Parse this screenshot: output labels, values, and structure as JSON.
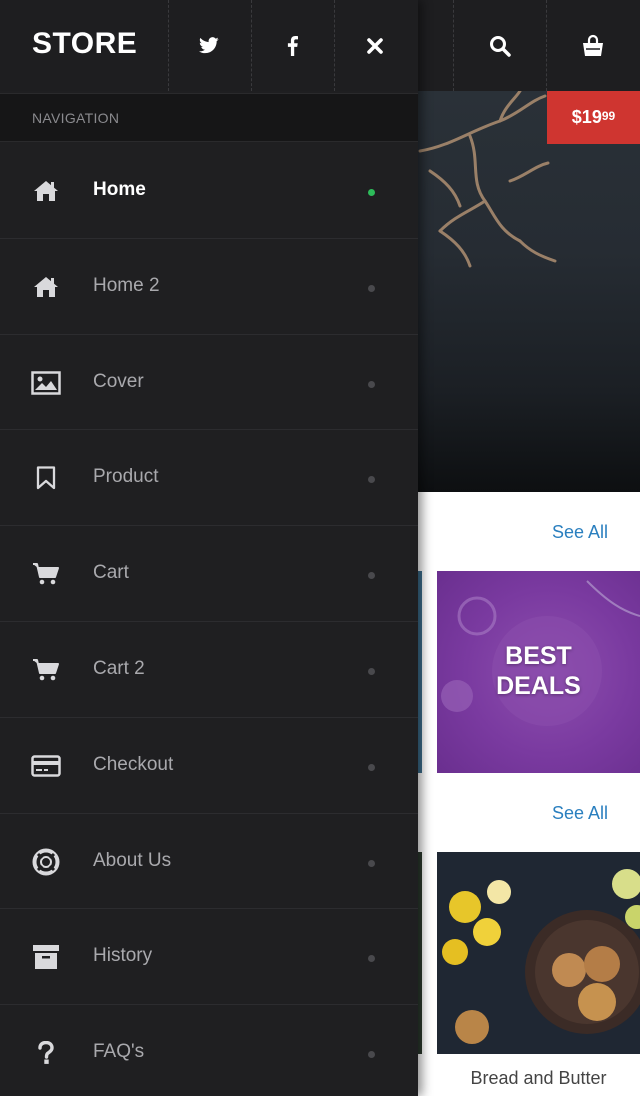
{
  "header": {
    "logo": "STORE",
    "icons": [
      "twitter-icon",
      "facebook-icon",
      "close-icon",
      "search-icon",
      "shopping-bag-icon"
    ]
  },
  "nav": {
    "section_label": "NAVIGATION",
    "items": [
      {
        "label": "Home",
        "icon": "home-icon",
        "active": true
      },
      {
        "label": "Home 2",
        "icon": "home-icon",
        "active": false
      },
      {
        "label": "Cover",
        "icon": "image-icon",
        "active": false
      },
      {
        "label": "Product",
        "icon": "bookmark-icon",
        "active": false
      },
      {
        "label": "Cart",
        "icon": "cart-icon",
        "active": false
      },
      {
        "label": "Cart 2",
        "icon": "cart-icon",
        "active": false
      },
      {
        "label": "Checkout",
        "icon": "credit-card-icon",
        "active": false
      },
      {
        "label": "About Us",
        "icon": "life-ring-icon",
        "active": false
      },
      {
        "label": "History",
        "icon": "archive-icon",
        "active": false
      },
      {
        "label": "FAQ's",
        "icon": "question-icon",
        "active": false
      }
    ]
  },
  "background_page": {
    "price_main": "$19",
    "price_cents": "99",
    "see_all_1": "See All",
    "see_all_2": "See All",
    "promo_text_line1": "BEST",
    "promo_text_line2": "DEALS",
    "product_caption": "Bread and Butter"
  },
  "colors": {
    "drawer_bg": "#1f1f21",
    "active_dot": "#2dbb5a",
    "price_tag": "#cf3530",
    "link": "#2a7fbf",
    "promo_purple": "#7a3aa0"
  }
}
